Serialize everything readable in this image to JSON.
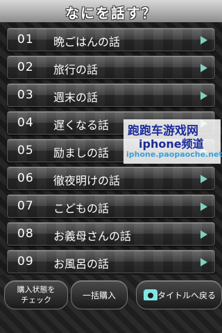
{
  "header": {
    "title": "なにを話す？"
  },
  "topics": [
    {
      "num": "01",
      "label": "晩ごはんの話"
    },
    {
      "num": "02",
      "label": "旅行の話"
    },
    {
      "num": "03",
      "label": "週末の話"
    },
    {
      "num": "04",
      "label": "遅くなる話"
    },
    {
      "num": "05",
      "label": "励ましの話"
    },
    {
      "num": "06",
      "label": "徹夜明けの話"
    },
    {
      "num": "07",
      "label": "こどもの話"
    },
    {
      "num": "08",
      "label": "お義母さんの話"
    },
    {
      "num": "09",
      "label": "お風呂の話"
    }
  ],
  "watermark": {
    "line1": "跑跑车游戏网",
    "line2": "iphone频道",
    "line3": "iphone.paopaoche.net"
  },
  "footer": {
    "check_label_1": "購入状態を",
    "check_label_2": "チェック",
    "bulk_label": "一括購入",
    "back_label": "タイトルへ戻る",
    "back_icon": "phone-icon"
  },
  "colors": {
    "arrow": "#7fd0c0",
    "accent": "#7fe6e6"
  }
}
